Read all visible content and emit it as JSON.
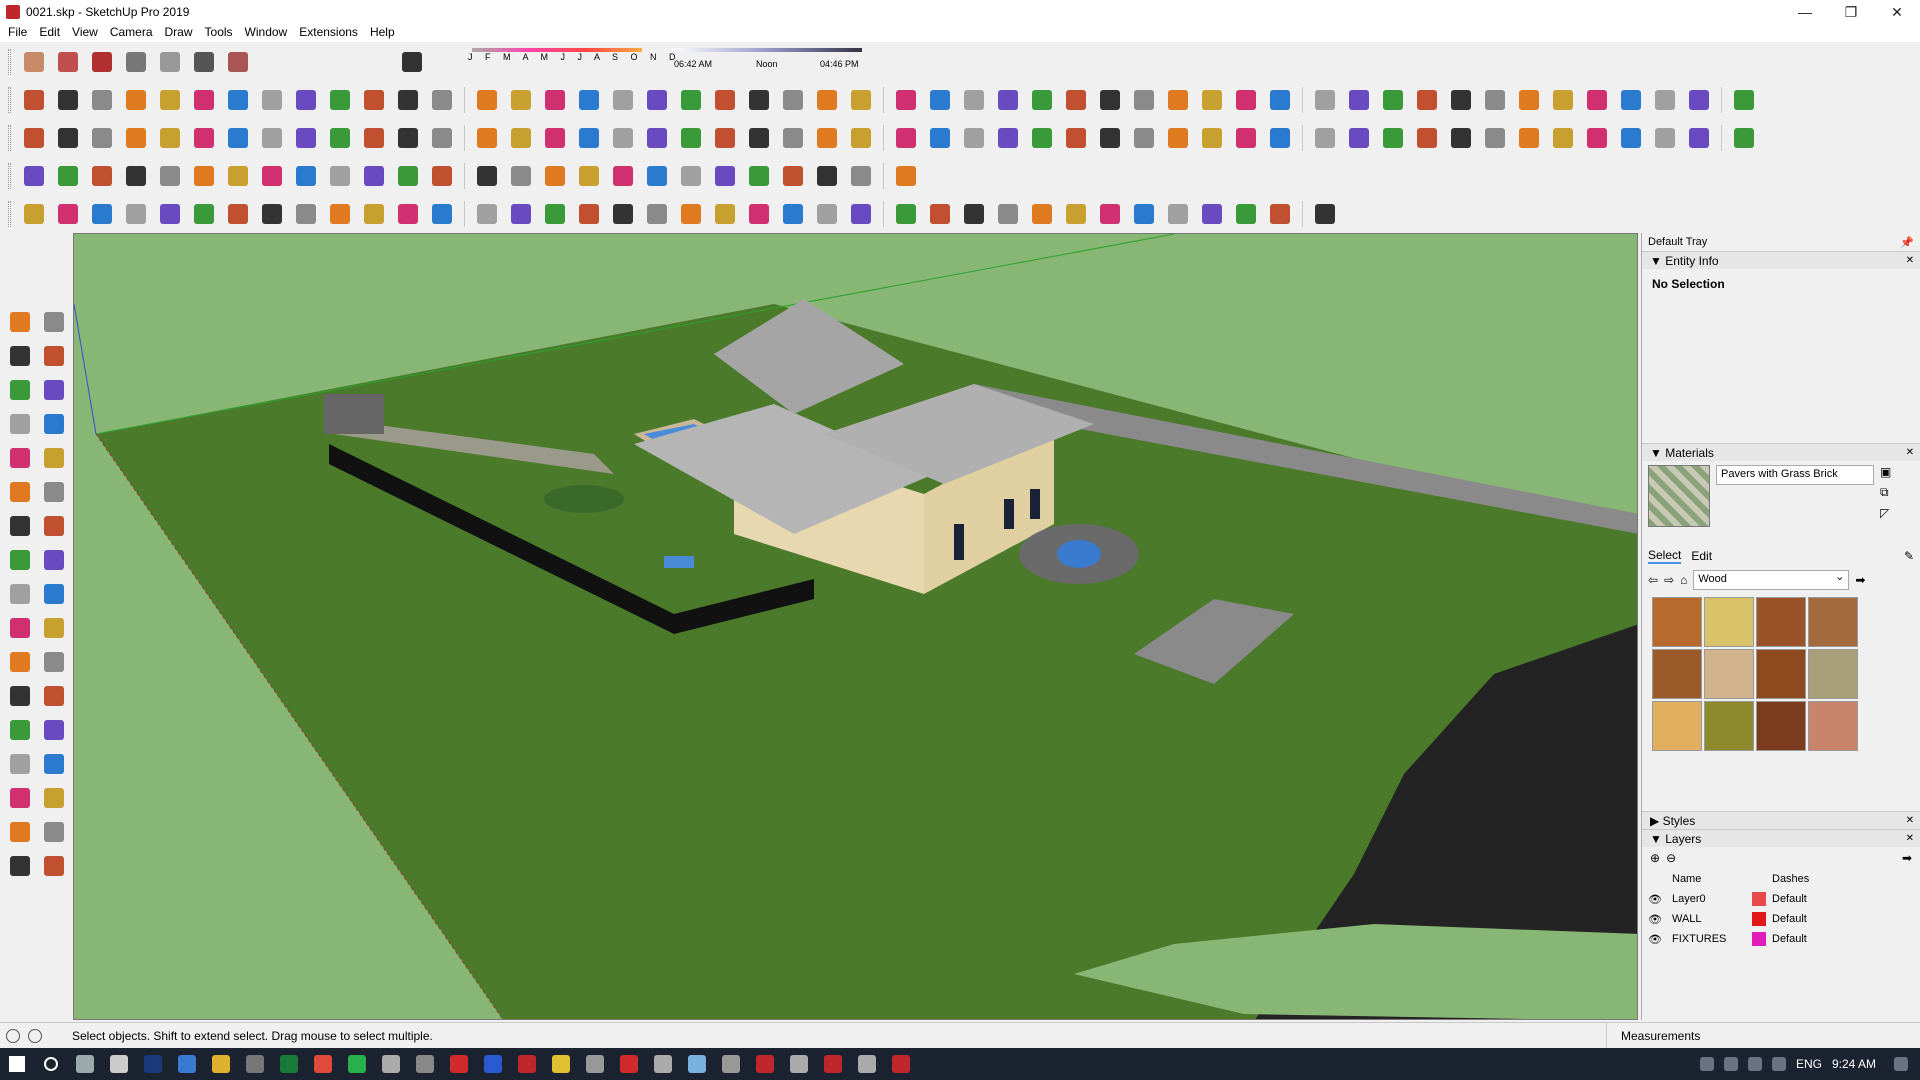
{
  "window": {
    "title": "0021.skp - SketchUp Pro 2019",
    "minimize": "—",
    "maximize": "❐",
    "close": "✕"
  },
  "menu": [
    "File",
    "Edit",
    "View",
    "Camera",
    "Draw",
    "Tools",
    "Window",
    "Extensions",
    "Help"
  ],
  "shadow_settings": {
    "months": "J F M A M J J A S O N D",
    "time_start": "06:42 AM",
    "time_mid": "Noon",
    "time_end": "04:46 PM"
  },
  "tray": {
    "title": "Default Tray",
    "entity_info": {
      "header": "Entity Info",
      "selection": "No Selection"
    },
    "materials": {
      "header": "Materials",
      "current_material": "Pavers with Grass Brick",
      "tab_select": "Select",
      "tab_edit": "Edit",
      "library": "Wood",
      "swatches": [
        "#b86a2e",
        "#d8c36a",
        "#9a5228",
        "#a26a3e",
        "#9a5a2a",
        "#d2b48c",
        "#8c4a1e",
        "#a8a07a",
        "#e0b060",
        "#8c8a2c",
        "#7a3c1c",
        "#c8846a"
      ]
    },
    "styles": {
      "header": "Styles"
    },
    "layers": {
      "header": "Layers",
      "col_name": "Name",
      "col_dashes": "Dashes",
      "rows": [
        {
          "name": "Layer0",
          "color": "#e84a4a",
          "dashes": "Default"
        },
        {
          "name": "WALL",
          "color": "#e01818",
          "dashes": "Default"
        },
        {
          "name": "FIXTURES",
          "color": "#e01dbb",
          "dashes": "Default"
        }
      ]
    }
  },
  "status": {
    "hint": "Select objects. Shift to extend select. Drag mouse to select multiple.",
    "measurements_label": "Measurements"
  },
  "taskbar": {
    "language": "ENG",
    "time": "9:24 AM"
  },
  "colors": {
    "viewport_light": "#88b674",
    "lawn": "#4a7a2a",
    "road": "#222222",
    "roof": "#a9a9a9",
    "wall": "#e8d8b0",
    "water": "#4a8bd8"
  }
}
